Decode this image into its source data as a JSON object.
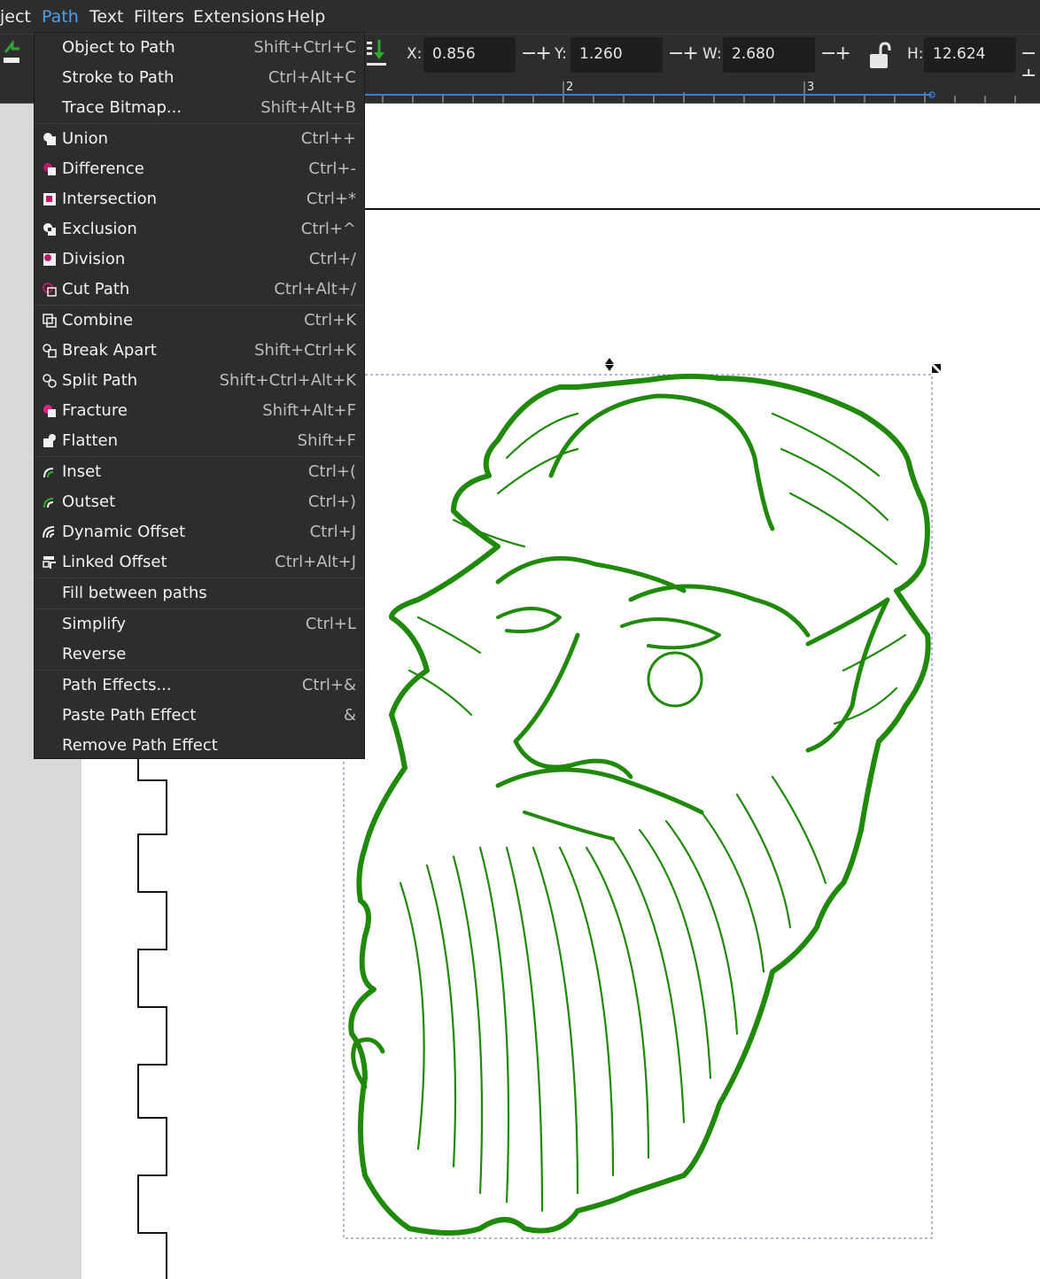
{
  "menubar": {
    "items": [
      "ject",
      "Path",
      "Text",
      "Filters",
      "Extensions",
      "Help"
    ],
    "active": "Path"
  },
  "toolbar": {
    "x_label": "X:",
    "x_value": "0.856",
    "y_label": "Y:",
    "y_value": "1.260",
    "w_label": "W:",
    "w_value": "2.680",
    "h_label": "H:",
    "h_value": "12.624",
    "pm": "−+"
  },
  "ruler": {
    "labels": [
      "2",
      "3"
    ]
  },
  "path_menu": {
    "items": [
      {
        "label": "Object to Path",
        "shortcut": "Shift+Ctrl+C",
        "icon": "none"
      },
      {
        "label": "Stroke to Path",
        "shortcut": "Ctrl+Alt+C",
        "icon": "none"
      },
      {
        "label": "Trace Bitmap...",
        "shortcut": "Shift+Alt+B",
        "icon": "none"
      },
      {
        "label": "Union",
        "shortcut": "Ctrl++",
        "icon": "union-icon"
      },
      {
        "label": "Difference",
        "shortcut": "Ctrl+-",
        "icon": "difference-icon"
      },
      {
        "label": "Intersection",
        "shortcut": "Ctrl+*",
        "icon": "intersection-icon"
      },
      {
        "label": "Exclusion",
        "shortcut": "Ctrl+^",
        "icon": "exclusion-icon"
      },
      {
        "label": "Division",
        "shortcut": "Ctrl+/",
        "icon": "division-icon"
      },
      {
        "label": "Cut Path",
        "shortcut": "Ctrl+Alt+/",
        "icon": "cut-path-icon"
      },
      {
        "label": "Combine",
        "shortcut": "Ctrl+K",
        "icon": "combine-icon"
      },
      {
        "label": "Break Apart",
        "shortcut": "Shift+Ctrl+K",
        "icon": "break-apart-icon"
      },
      {
        "label": "Split Path",
        "shortcut": "Shift+Ctrl+Alt+K",
        "icon": "split-path-icon"
      },
      {
        "label": "Fracture",
        "shortcut": "Shift+Alt+F",
        "icon": "fracture-icon"
      },
      {
        "label": "Flatten",
        "shortcut": "Shift+F",
        "icon": "flatten-icon"
      },
      {
        "label": "Inset",
        "shortcut": "Ctrl+(",
        "icon": "inset-icon"
      },
      {
        "label": "Outset",
        "shortcut": "Ctrl+)",
        "icon": "outset-icon"
      },
      {
        "label": "Dynamic Offset",
        "shortcut": "Ctrl+J",
        "icon": "dynamic-offset-icon"
      },
      {
        "label": "Linked Offset",
        "shortcut": "Ctrl+Alt+J",
        "icon": "linked-offset-icon"
      },
      {
        "label": "Fill between paths",
        "shortcut": "",
        "icon": "none"
      },
      {
        "label": "Simplify",
        "shortcut": "Ctrl+L",
        "icon": "none"
      },
      {
        "label": "Reverse",
        "shortcut": "",
        "icon": "none"
      },
      {
        "label": "Path Effects...",
        "shortcut": "Ctrl+&",
        "icon": "none"
      },
      {
        "label": "Paste Path Effect",
        "shortcut": "&",
        "icon": "none"
      },
      {
        "label": "Remove Path Effect",
        "shortcut": "",
        "icon": "none"
      }
    ]
  },
  "colors": {
    "accent": "#4ea1e8",
    "drawing_green": "#1f8a0a",
    "icon_magenta": "#c2186b",
    "menu_bg": "#2d2d2d"
  }
}
